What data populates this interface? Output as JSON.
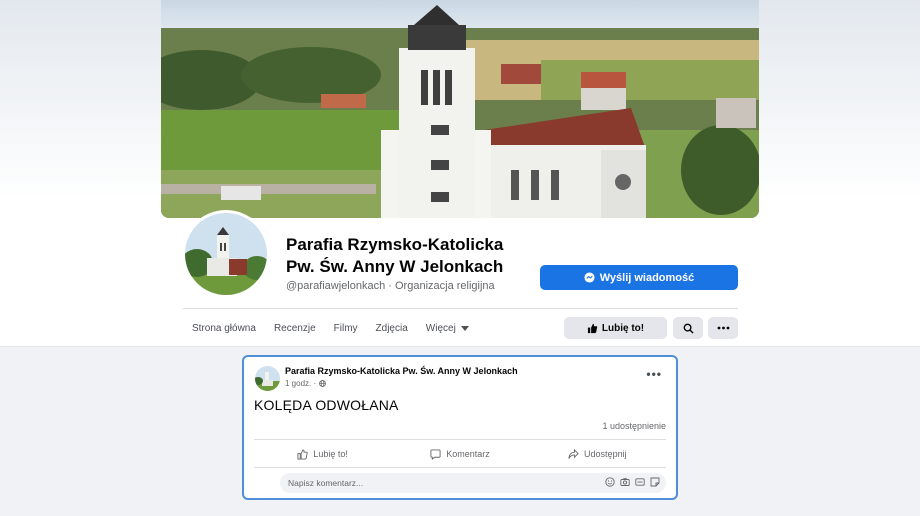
{
  "page": {
    "name_line1": "Parafia Rzymsko-Katolicka",
    "name_line2": "Pw. Św. Anny W Jelonkach",
    "subtitle": "@parafiawjelonkach · Organizacja religijna",
    "message_button": "Wyślij wiadomość"
  },
  "tabs": [
    {
      "label": "Strona główna"
    },
    {
      "label": "Recenzje"
    },
    {
      "label": "Filmy"
    },
    {
      "label": "Zdjęcia"
    },
    {
      "label": "Więcej"
    }
  ],
  "actions": {
    "like_label": "Lubię to!",
    "search_icon": "search-icon",
    "more_icon": "more-icon"
  },
  "post": {
    "author": "Parafia Rzymsko-Katolicka Pw. Św. Anny W Jelonkach",
    "time": "1 godz. ·",
    "text": "KOLĘDA ODWOŁANA",
    "share_count": "1 udostępnienie",
    "like_label": "Lubię to!",
    "comment_label": "Komentarz",
    "share_label": "Udostępnij",
    "comment_placeholder": "Napisz komentarz..."
  },
  "colors": {
    "accent": "#1b74e4",
    "post_border": "#4f8ed8"
  }
}
